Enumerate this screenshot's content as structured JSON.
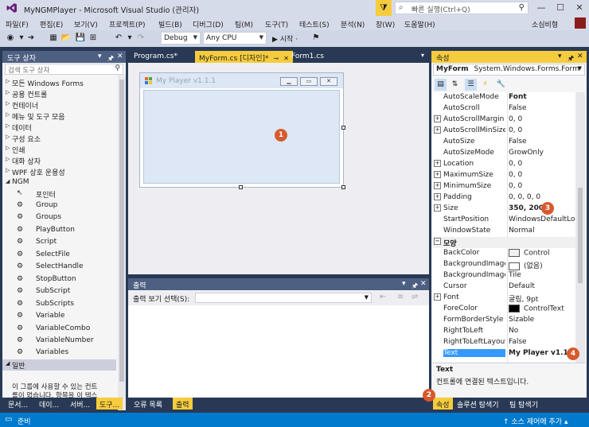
{
  "window": {
    "title": "MyNGMPlayer - Microsoft Visual Studio  (관리자)",
    "quick_launch_placeholder": "빠른 실행(Ctrl+Q)",
    "minimize": "—",
    "maximize": "☐",
    "close": "✕"
  },
  "menu": {
    "items": [
      "파일(F)",
      "편집(E)",
      "보기(V)",
      "프로젝트(P)",
      "빌드(B)",
      "디버그(D)",
      "팀(M)",
      "도구(T)",
      "테스트(S)",
      "분석(N)",
      "창(W)",
      "도움말(H)"
    ],
    "user": "소심비형"
  },
  "toolbar": {
    "config": "Debug",
    "platform": "Any CPU",
    "start": "▶ 시작 ·"
  },
  "toolbox": {
    "title": "도구 상자",
    "search_placeholder": "검색 도구 상자",
    "categories": [
      "모든 Windows Forms",
      "공용 컨트롤",
      "컨테이너",
      "메뉴 및 도구 모음",
      "데이터",
      "구성 요소",
      "인쇄",
      "대화 상자",
      "WPF 상호 운용성"
    ],
    "group": "NGM",
    "items": [
      "포인터",
      "Group",
      "Groups",
      "PlayButton",
      "Script",
      "SelectFile",
      "SelectHandle",
      "StopButton",
      "SubScript",
      "SubScripts",
      "Variable",
      "VariableCombo",
      "VariableNumber",
      "Variables"
    ],
    "general": "일반",
    "general_text_1": "이 그룹에 사용할 수 있는 컨트",
    "general_text_2": "롤이 없습니다. 항목을 이 텍스"
  },
  "left_tabs": [
    "문서...",
    "데이...",
    "서버...",
    "도구..."
  ],
  "doc_tabs": {
    "tab1": "Program.cs*",
    "tab2": "MyForm.cs [디자인]*",
    "tab3": "Form1.cs"
  },
  "designer": {
    "form_title": "My Player v1.1.1"
  },
  "output": {
    "title": "출력",
    "label": "출력 보기 선택(S):"
  },
  "bottom_tabs": [
    "오류 목록",
    "출력"
  ],
  "properties": {
    "title": "속성",
    "object": "MyForm",
    "object_type": "System.Windows.Forms.Form",
    "rows": [
      {
        "name": "AutoScaleMode",
        "value": "Font",
        "bold": true
      },
      {
        "name": "AutoScroll",
        "value": "False"
      },
      {
        "name": "AutoScrollMargin",
        "value": "0, 0",
        "expand": true
      },
      {
        "name": "AutoScrollMinSize",
        "value": "0, 0",
        "expand": true
      },
      {
        "name": "AutoSize",
        "value": "False"
      },
      {
        "name": "AutoSizeMode",
        "value": "GrowOnly"
      },
      {
        "name": "Location",
        "value": "0, 0",
        "expand": true
      },
      {
        "name": "MaximumSize",
        "value": "0, 0",
        "expand": true
      },
      {
        "name": "MinimumSize",
        "value": "0, 0",
        "expand": true
      },
      {
        "name": "Padding",
        "value": "0, 0, 0, 0",
        "expand": true
      },
      {
        "name": "Size",
        "value": "350, 200",
        "expand": true,
        "bold": true
      },
      {
        "name": "StartPosition",
        "value": "WindowsDefaultLocation"
      },
      {
        "name": "WindowState",
        "value": "Normal"
      },
      {
        "name": "모양",
        "category": true
      },
      {
        "name": "BackColor",
        "value": "Control",
        "swatch": "#f0f0f0"
      },
      {
        "name": "BackgroundImage",
        "value": "(없음)",
        "swatch": "#ffffff"
      },
      {
        "name": "BackgroundImageLayout",
        "value": "Tile"
      },
      {
        "name": "Cursor",
        "value": "Default"
      },
      {
        "name": "Font",
        "value": "굴림, 9pt",
        "expand": true
      },
      {
        "name": "ForeColor",
        "value": "ControlText",
        "swatch": "#000000"
      },
      {
        "name": "FormBorderStyle",
        "value": "Sizable"
      },
      {
        "name": "RightToLeft",
        "value": "No"
      },
      {
        "name": "RightToLeftLayout",
        "value": "False"
      },
      {
        "name": "Text",
        "value": "My Player v1.1.1",
        "bold": true,
        "selected": true
      }
    ],
    "desc_title": "Text",
    "desc_text": "컨트롤에 연결된 텍스트입니다."
  },
  "right_tabs": [
    "속성",
    "솔루션 탐색기",
    "팀 탐색기"
  ],
  "badges": [
    "1",
    "2",
    "3",
    "4"
  ],
  "status": {
    "text": "준비",
    "source_control": "↑ 소스 제어에 추가 ▴"
  }
}
